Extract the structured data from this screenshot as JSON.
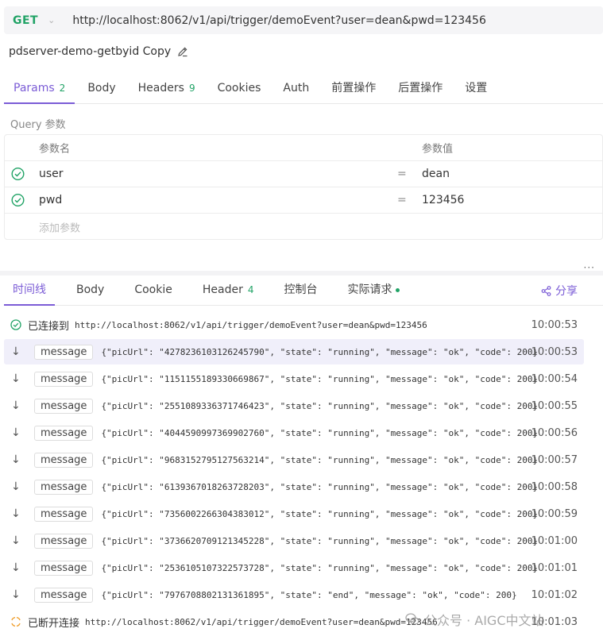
{
  "request": {
    "method": "GET",
    "url": "http://localhost:8062/v1/api/trigger/demoEvent?user=dean&pwd=123456",
    "name": "pdserver-demo-getbyid Copy"
  },
  "request_tabs": [
    {
      "label": "Params",
      "badge": "2"
    },
    {
      "label": "Body",
      "badge": ""
    },
    {
      "label": "Headers",
      "badge": "9"
    },
    {
      "label": "Cookies",
      "badge": ""
    },
    {
      "label": "Auth",
      "badge": ""
    },
    {
      "label": "前置操作",
      "badge": ""
    },
    {
      "label": "后置操作",
      "badge": ""
    },
    {
      "label": "设置",
      "badge": ""
    }
  ],
  "query": {
    "section_label": "Query 参数",
    "col_name": "参数名",
    "col_value": "参数值",
    "eq": "=",
    "rows": [
      {
        "name": "user",
        "value": "dean"
      },
      {
        "name": "pwd",
        "value": "123456"
      }
    ],
    "add_placeholder": "添加参数"
  },
  "more": "···",
  "response_tabs": [
    {
      "label": "时间线",
      "badge": ""
    },
    {
      "label": "Body",
      "badge": ""
    },
    {
      "label": "Cookie",
      "badge": ""
    },
    {
      "label": "Header",
      "badge": "4"
    },
    {
      "label": "控制台",
      "badge": ""
    },
    {
      "label": "实际请求",
      "badge": ""
    }
  ],
  "share_label": "分享",
  "timeline": {
    "connected": {
      "label": "已连接到",
      "url": "http://localhost:8062/v1/api/trigger/demoEvent?user=dean&pwd=123456",
      "time": "10:00:53"
    },
    "messages": [
      {
        "tag": "message",
        "payload": "{\"picUrl\": \"4278236103126245790\", \"state\": \"running\", \"message\": \"ok\", \"code\": 200}",
        "time": "10:00:53"
      },
      {
        "tag": "message",
        "payload": "{\"picUrl\": \"1151155189330669867\", \"state\": \"running\", \"message\": \"ok\", \"code\": 200}",
        "time": "10:00:54"
      },
      {
        "tag": "message",
        "payload": "{\"picUrl\": \"2551089336371746423\", \"state\": \"running\", \"message\": \"ok\", \"code\": 200}",
        "time": "10:00:55"
      },
      {
        "tag": "message",
        "payload": "{\"picUrl\": \"4044590997369902760\", \"state\": \"running\", \"message\": \"ok\", \"code\": 200}",
        "time": "10:00:56"
      },
      {
        "tag": "message",
        "payload": "{\"picUrl\": \"9683152795127563214\", \"state\": \"running\", \"message\": \"ok\", \"code\": 200}",
        "time": "10:00:57"
      },
      {
        "tag": "message",
        "payload": "{\"picUrl\": \"6139367018263728203\", \"state\": \"running\", \"message\": \"ok\", \"code\": 200}",
        "time": "10:00:58"
      },
      {
        "tag": "message",
        "payload": "{\"picUrl\": \"7356002266304383012\", \"state\": \"running\", \"message\": \"ok\", \"code\": 200}",
        "time": "10:00:59"
      },
      {
        "tag": "message",
        "payload": "{\"picUrl\": \"3736620709121345228\", \"state\": \"running\", \"message\": \"ok\", \"code\": 200}",
        "time": "10:01:00"
      },
      {
        "tag": "message",
        "payload": "{\"picUrl\": \"2536105107322573728\", \"state\": \"running\", \"message\": \"ok\", \"code\": 200}",
        "time": "10:01:01"
      },
      {
        "tag": "message",
        "payload": "{\"picUrl\": \"7976708802131361895\", \"state\": \"end\", \"message\": \"ok\", \"code\": 200}",
        "time": "10:01:02"
      }
    ],
    "disconnected": {
      "label": "已断开连接",
      "url": "http://localhost:8062/v1/api/trigger/demoEvent?user=dean&pwd=123456",
      "time": "10:01:03"
    }
  },
  "watermark": "公众号 · AIGC中文站",
  "colors": {
    "accent": "#7b5cd6",
    "success": "#21a366",
    "warning": "#f0a030",
    "highlight_row": "#f0effa"
  }
}
